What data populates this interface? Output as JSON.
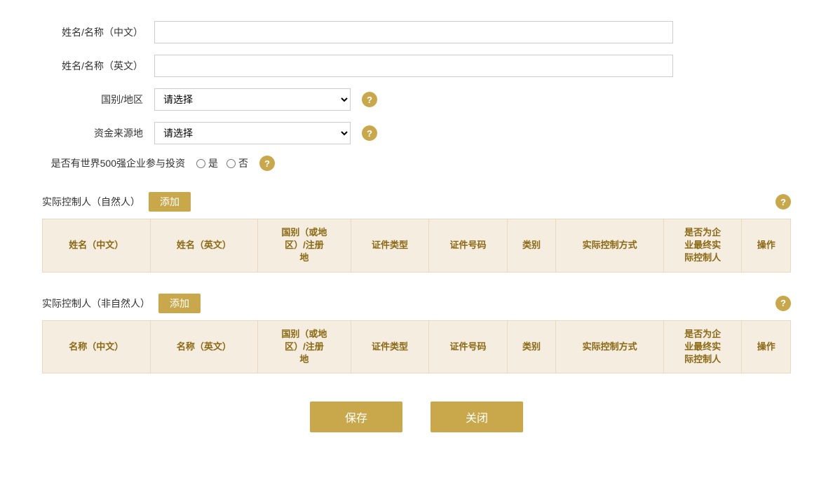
{
  "form": {
    "name_cn_label": "姓名/名称（中文）",
    "name_en_label": "姓名/名称（英文）",
    "country_label": "国别/地区",
    "fund_source_label": "资金来源地",
    "fortune500_label": "是否有世界500强企业参与投资",
    "country_placeholder": "请选择",
    "fund_source_placeholder": "请选择",
    "radio_yes": "是",
    "radio_no": "否"
  },
  "natural_section": {
    "title": "实际控制人（自然人）",
    "add_label": "添加",
    "columns": [
      "姓名（中文）",
      "姓名（英文）",
      "国别（或地区）/注册地",
      "证件类型",
      "证件号码",
      "类别",
      "实际控制方式",
      "是否为企业最终实际控制人",
      "操作"
    ]
  },
  "non_natural_section": {
    "title": "实际控制人（非自然人）",
    "add_label": "添加",
    "columns": [
      "名称（中文）",
      "名称（英文）",
      "国别（或地区）/注册地",
      "证件类型",
      "证件号码",
      "类别",
      "实际控制方式",
      "是否为企业最终实际控制人",
      "操作"
    ]
  },
  "buttons": {
    "save": "保存",
    "close": "关闭"
  },
  "help_icon": "?"
}
